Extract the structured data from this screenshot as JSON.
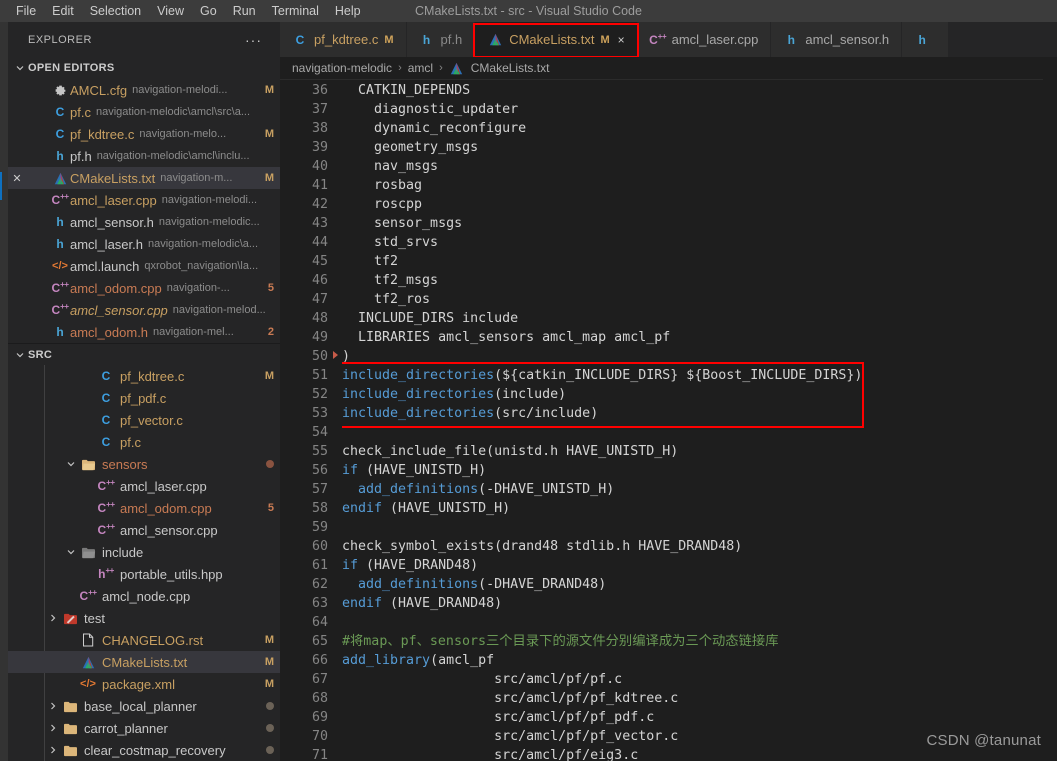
{
  "window": {
    "title": "CMakeLists.txt - src - Visual Studio Code",
    "menus": [
      "File",
      "Edit",
      "Selection",
      "View",
      "Go",
      "Run",
      "Terminal",
      "Help"
    ]
  },
  "sidebar": {
    "title": "EXPLORER",
    "more_actions": "···",
    "sections": [
      {
        "label": "OPEN EDITORS"
      },
      {
        "label": "SRC"
      }
    ],
    "open_editors": [
      {
        "icon": "gear-icon",
        "icon_glyph": "⚙",
        "icon_color": "#c5c5c5",
        "name": "AMCL.cfg",
        "name_color": "#c8a062",
        "desc": "navigation-melodi...",
        "badge": "M",
        "badge_color": "#c8a062",
        "selected": false,
        "closable": false
      },
      {
        "icon": "c-file-icon",
        "icon_glyph": "C",
        "icon_color": "#3d9fe0",
        "name": "pf.c",
        "name_color": "#c8a062",
        "desc": "navigation-melodic\\amcl\\src\\a...",
        "badge": "",
        "badge_color": "",
        "selected": false,
        "closable": false
      },
      {
        "icon": "c-file-icon",
        "icon_glyph": "C",
        "icon_color": "#3d9fe0",
        "name": "pf_kdtree.c",
        "name_color": "#c8a062",
        "desc": "navigation-melo...",
        "badge": "M",
        "badge_color": "#c8a062",
        "selected": false,
        "closable": false
      },
      {
        "icon": "h-file-icon",
        "icon_glyph": "h",
        "icon_color": "#4aa5d6",
        "name": "pf.h",
        "name_color": "#c8c8c8",
        "desc": "navigation-melodic\\amcl\\inclu...",
        "badge": "",
        "badge_color": "",
        "selected": false,
        "closable": false
      },
      {
        "icon": "cmake-icon",
        "icon_glyph": "▲",
        "icon_color": "#dd4c3f",
        "name": "CMakeLists.txt",
        "name_color": "#c8a062",
        "desc": "navigation-m...",
        "badge": "M",
        "badge_color": "#c8a062",
        "selected": true,
        "closable": true
      },
      {
        "icon": "cpp-file-icon",
        "icon_glyph": "C⁺⁺",
        "icon_color": "#c586c0",
        "name": "amcl_laser.cpp",
        "name_color": "#c8a062",
        "desc": "navigation-melodi...",
        "badge": "",
        "badge_color": "",
        "selected": false,
        "closable": false
      },
      {
        "icon": "h-file-icon",
        "icon_glyph": "h",
        "icon_color": "#4aa5d6",
        "name": "amcl_sensor.h",
        "name_color": "#c8c8c8",
        "desc": "navigation-melodic...",
        "badge": "",
        "badge_color": "",
        "selected": false,
        "closable": false
      },
      {
        "icon": "h-file-icon",
        "icon_glyph": "h",
        "icon_color": "#4aa5d6",
        "name": "amcl_laser.h",
        "name_color": "#c8c8c8",
        "desc": "navigation-melodic\\a...",
        "badge": "",
        "badge_color": "",
        "selected": false,
        "closable": false
      },
      {
        "icon": "xml-file-icon",
        "icon_glyph": "</>",
        "icon_color": "#e37933",
        "name": "amcl.launch",
        "name_color": "#c8c8c8",
        "desc": "qxrobot_navigation\\la...",
        "badge": "",
        "badge_color": "",
        "selected": false,
        "closable": false
      },
      {
        "icon": "cpp-file-icon",
        "icon_glyph": "C⁺⁺",
        "icon_color": "#c586c0",
        "name": "amcl_odom.cpp",
        "name_color": "#c97b54",
        "desc": "navigation-...",
        "badge": "5",
        "badge_color": "#c97b54",
        "selected": false,
        "closable": false
      },
      {
        "icon": "cpp-file-icon",
        "icon_glyph": "C⁺⁺",
        "icon_color": "#c586c0",
        "name": "amcl_sensor.cpp",
        "name_color": "#c8a062",
        "desc": "navigation-melod...",
        "badge": "",
        "badge_color": "",
        "selected": false,
        "closable": false,
        "italic": true
      },
      {
        "icon": "h-file-icon",
        "icon_glyph": "h",
        "icon_color": "#4aa5d6",
        "name": "amcl_odom.h",
        "name_color": "#c97b54",
        "desc": "navigation-mel...",
        "badge": "2",
        "badge_color": "#c97b54",
        "selected": false,
        "closable": false
      }
    ],
    "src_tree": [
      {
        "depth": 3,
        "kind": "file",
        "icon": "c-file-icon",
        "icon_glyph": "C",
        "icon_color": "#3d9fe0",
        "name": "pf_kdtree.c",
        "name_color": "#c8a062",
        "badge": "M",
        "badge_color": "#c8a062",
        "selected": false
      },
      {
        "depth": 3,
        "kind": "file",
        "icon": "c-file-icon",
        "icon_glyph": "C",
        "icon_color": "#3d9fe0",
        "name": "pf_pdf.c",
        "name_color": "#c8a062",
        "badge": "",
        "badge_color": "",
        "selected": false
      },
      {
        "depth": 3,
        "kind": "file",
        "icon": "c-file-icon",
        "icon_glyph": "C",
        "icon_color": "#3d9fe0",
        "name": "pf_vector.c",
        "name_color": "#c8a062",
        "badge": "",
        "badge_color": "",
        "selected": false
      },
      {
        "depth": 3,
        "kind": "file",
        "icon": "c-file-icon",
        "icon_glyph": "C",
        "icon_color": "#3d9fe0",
        "name": "pf.c",
        "name_color": "#c8a062",
        "badge": "",
        "badge_color": "",
        "selected": false
      },
      {
        "depth": 2,
        "kind": "folder-open",
        "icon": "folder-open-icon",
        "name": "sensors",
        "name_color": "#c97b54",
        "badge": "●",
        "badge_color": "#8a5340",
        "selected": false
      },
      {
        "depth": 3,
        "kind": "file",
        "icon": "cpp-file-icon",
        "icon_glyph": "C⁺⁺",
        "icon_color": "#c586c0",
        "name": "amcl_laser.cpp",
        "name_color": "#c8c8c8",
        "badge": "",
        "badge_color": "",
        "selected": false
      },
      {
        "depth": 3,
        "kind": "file",
        "icon": "cpp-file-icon",
        "icon_glyph": "C⁺⁺",
        "icon_color": "#c586c0",
        "name": "amcl_odom.cpp",
        "name_color": "#c97b54",
        "badge": "5",
        "badge_color": "#c97b54",
        "selected": false
      },
      {
        "depth": 3,
        "kind": "file",
        "icon": "cpp-file-icon",
        "icon_glyph": "C⁺⁺",
        "icon_color": "#c586c0",
        "name": "amcl_sensor.cpp",
        "name_color": "#c8c8c8",
        "badge": "",
        "badge_color": "",
        "selected": false
      },
      {
        "depth": 2,
        "kind": "folder-open",
        "icon": "folder-open-gray-icon",
        "name": "include",
        "name_color": "#c8c8c8",
        "badge": "",
        "badge_color": "",
        "selected": false
      },
      {
        "depth": 3,
        "kind": "file",
        "icon": "hpp-file-icon",
        "icon_glyph": "h⁺⁺",
        "icon_color": "#c586c0",
        "name": "portable_utils.hpp",
        "name_color": "#c8c8c8",
        "badge": "",
        "badge_color": "",
        "selected": false
      },
      {
        "depth": 2,
        "kind": "file",
        "icon": "cpp-file-icon",
        "icon_glyph": "C⁺⁺",
        "icon_color": "#c586c0",
        "name": "amcl_node.cpp",
        "name_color": "#c8c8c8",
        "badge": "",
        "badge_color": "",
        "selected": false
      },
      {
        "depth": 1,
        "kind": "folder-closed",
        "icon": "folder-test-icon",
        "name": "test",
        "name_color": "#c8c8c8",
        "badge": "",
        "badge_color": "",
        "selected": false
      },
      {
        "depth": 2,
        "kind": "file",
        "icon": "rst-file-icon",
        "icon_glyph": "⬜",
        "icon_color": "#c8c8c8",
        "name": "CHANGELOG.rst",
        "name_color": "#c8a062",
        "badge": "M",
        "badge_color": "#c8a062",
        "selected": false
      },
      {
        "depth": 2,
        "kind": "file",
        "icon": "cmake-icon",
        "icon_glyph": "▲",
        "icon_color": "#dd4c3f",
        "name": "CMakeLists.txt",
        "name_color": "#c8a062",
        "badge": "M",
        "badge_color": "#c8a062",
        "selected": true
      },
      {
        "depth": 2,
        "kind": "file",
        "icon": "xml-file-icon",
        "icon_glyph": "</>",
        "icon_color": "#e37933",
        "name": "package.xml",
        "name_color": "#c8a062",
        "badge": "M",
        "badge_color": "#c8a062",
        "selected": false
      },
      {
        "depth": 1,
        "kind": "folder-closed",
        "icon": "folder-closed-icon",
        "name": "base_local_planner",
        "name_color": "#c8c8c8",
        "badge": "●",
        "badge_color": "#6b6257",
        "selected": false
      },
      {
        "depth": 1,
        "kind": "folder-closed",
        "icon": "folder-closed-icon",
        "name": "carrot_planner",
        "name_color": "#c8c8c8",
        "badge": "●",
        "badge_color": "#6b6257",
        "selected": false
      },
      {
        "depth": 1,
        "kind": "folder-closed",
        "icon": "folder-closed-icon",
        "name": "clear_costmap_recovery",
        "name_color": "#c8c8c8",
        "badge": "●",
        "badge_color": "#6b6257",
        "selected": false
      }
    ]
  },
  "tabs": [
    {
      "icon": "c-file-icon",
      "icon_glyph": "C",
      "icon_color": "#3d9fe0",
      "label": "pf_kdtree.c",
      "dirty": "M",
      "active": false,
      "closable": false,
      "label_color": "#c8a062"
    },
    {
      "icon": "h-file-icon",
      "icon_glyph": "h",
      "icon_color": "#4aa5d6",
      "label": "pf.h",
      "dirty": "",
      "active": false,
      "closable": false,
      "label_color": "#8a8a8a"
    },
    {
      "icon": "cmake-icon",
      "icon_glyph": "▲",
      "icon_color": "#dd4c3f",
      "label": "CMakeLists.txt",
      "dirty": "M",
      "active": true,
      "closable": true,
      "close_glyph": "×",
      "label_color": "#c8a062"
    },
    {
      "icon": "cpp-file-icon",
      "icon_glyph": "C⁺⁺",
      "icon_color": "#c586c0",
      "label": "amcl_laser.cpp",
      "dirty": "",
      "active": false,
      "closable": false,
      "label_color": "#a8a8a8"
    },
    {
      "icon": "h-file-icon",
      "icon_glyph": "h",
      "icon_color": "#4aa5d6",
      "label": "amcl_sensor.h",
      "dirty": "",
      "active": false,
      "closable": false,
      "label_color": "#a8a8a8"
    },
    {
      "icon": "h-file-icon",
      "icon_glyph": "h",
      "icon_color": "#4aa5d6",
      "label": "",
      "dirty": "",
      "active": false,
      "closable": false,
      "label_color": "#a8a8a8"
    }
  ],
  "breadcrumbs": {
    "items": [
      "navigation-melodic",
      "amcl",
      "CMakeLists.txt"
    ],
    "separator": "›",
    "file_icon": "cmake-icon",
    "file_icon_glyph": "▲"
  },
  "editor": {
    "first_line": 36,
    "highlight_color": "#ff0000",
    "lines": [
      {
        "n": 36,
        "segs": [
          {
            "t": "  CATKIN_DEPENDS",
            "c": "t-plain"
          }
        ]
      },
      {
        "n": 37,
        "segs": [
          {
            "t": "    diagnostic_updater",
            "c": "t-plain"
          }
        ]
      },
      {
        "n": 38,
        "segs": [
          {
            "t": "    dynamic_reconfigure",
            "c": "t-plain"
          }
        ]
      },
      {
        "n": 39,
        "segs": [
          {
            "t": "    geometry_msgs",
            "c": "t-plain"
          }
        ]
      },
      {
        "n": 40,
        "segs": [
          {
            "t": "    nav_msgs",
            "c": "t-plain"
          }
        ]
      },
      {
        "n": 41,
        "segs": [
          {
            "t": "    rosbag",
            "c": "t-plain"
          }
        ]
      },
      {
        "n": 42,
        "segs": [
          {
            "t": "    roscpp",
            "c": "t-plain"
          }
        ]
      },
      {
        "n": 43,
        "segs": [
          {
            "t": "    sensor_msgs",
            "c": "t-plain"
          }
        ]
      },
      {
        "n": 44,
        "segs": [
          {
            "t": "    std_srvs",
            "c": "t-plain"
          }
        ]
      },
      {
        "n": 45,
        "segs": [
          {
            "t": "    tf2",
            "c": "t-plain"
          }
        ]
      },
      {
        "n": 46,
        "segs": [
          {
            "t": "    tf2_msgs",
            "c": "t-plain"
          }
        ]
      },
      {
        "n": 47,
        "segs": [
          {
            "t": "    tf2_ros",
            "c": "t-plain"
          }
        ]
      },
      {
        "n": 48,
        "segs": [
          {
            "t": "  INCLUDE_DIRS include",
            "c": "t-plain"
          }
        ]
      },
      {
        "n": 49,
        "segs": [
          {
            "t": "  LIBRARIES amcl_sensors amcl_map amcl_pf",
            "c": "t-plain"
          }
        ]
      },
      {
        "n": 50,
        "segs": [
          {
            "t": ")",
            "c": "t-plain"
          }
        ],
        "fold": true
      },
      {
        "n": 51,
        "segs": [
          {
            "t": "include_directories",
            "c": "t-fn"
          },
          {
            "t": "(",
            "c": "t-punct"
          },
          {
            "t": "${catkin_INCLUDE_DIRS} ${Boost_INCLUDE_DIRS}",
            "c": "t-plain"
          },
          {
            "t": ")",
            "c": "t-punct"
          }
        ],
        "boxed": true
      },
      {
        "n": 52,
        "segs": [
          {
            "t": "include_directories",
            "c": "t-fn"
          },
          {
            "t": "(",
            "c": "t-punct"
          },
          {
            "t": "include",
            "c": "t-plain"
          },
          {
            "t": ")",
            "c": "t-punct"
          }
        ],
        "boxed": true
      },
      {
        "n": 53,
        "segs": [
          {
            "t": "include_directories",
            "c": "t-fn"
          },
          {
            "t": "(",
            "c": "t-punct"
          },
          {
            "t": "src/include",
            "c": "t-plain"
          },
          {
            "t": ")",
            "c": "t-punct"
          }
        ],
        "boxed": true
      },
      {
        "n": 54,
        "segs": [
          {
            "t": "",
            "c": "t-plain"
          }
        ]
      },
      {
        "n": 55,
        "segs": [
          {
            "t": "check_include_file",
            "c": "t-plain"
          },
          {
            "t": "(unistd.h HAVE_UNISTD_H)",
            "c": "t-plain"
          }
        ]
      },
      {
        "n": 56,
        "segs": [
          {
            "t": "if",
            "c": "t-kw"
          },
          {
            "t": " (HAVE_UNISTD_H)",
            "c": "t-plain"
          }
        ]
      },
      {
        "n": 57,
        "segs": [
          {
            "t": "  ",
            "c": "t-plain"
          },
          {
            "t": "add_definitions",
            "c": "t-fn"
          },
          {
            "t": "(-DHAVE_UNISTD_H)",
            "c": "t-plain"
          }
        ]
      },
      {
        "n": 58,
        "segs": [
          {
            "t": "endif",
            "c": "t-kw"
          },
          {
            "t": " (HAVE_UNISTD_H)",
            "c": "t-plain"
          }
        ]
      },
      {
        "n": 59,
        "segs": [
          {
            "t": "",
            "c": "t-plain"
          }
        ]
      },
      {
        "n": 60,
        "segs": [
          {
            "t": "check_symbol_exists",
            "c": "t-plain"
          },
          {
            "t": "(drand48 stdlib.h HAVE_DRAND48)",
            "c": "t-plain"
          }
        ]
      },
      {
        "n": 61,
        "segs": [
          {
            "t": "if",
            "c": "t-kw"
          },
          {
            "t": " (HAVE_DRAND48)",
            "c": "t-plain"
          }
        ]
      },
      {
        "n": 62,
        "segs": [
          {
            "t": "  ",
            "c": "t-plain"
          },
          {
            "t": "add_definitions",
            "c": "t-fn"
          },
          {
            "t": "(-DHAVE_DRAND48)",
            "c": "t-plain"
          }
        ]
      },
      {
        "n": 63,
        "segs": [
          {
            "t": "endif",
            "c": "t-kw"
          },
          {
            "t": " (HAVE_DRAND48)",
            "c": "t-plain"
          }
        ]
      },
      {
        "n": 64,
        "segs": [
          {
            "t": "",
            "c": "t-plain"
          }
        ]
      },
      {
        "n": 65,
        "segs": [
          {
            "t": "#将map、pf、sensors三个目录下的源文件分别编译成为三个动态链接库",
            "c": "t-comment"
          }
        ]
      },
      {
        "n": 66,
        "segs": [
          {
            "t": "add_library",
            "c": "t-fn"
          },
          {
            "t": "(amcl_pf",
            "c": "t-plain"
          }
        ]
      },
      {
        "n": 67,
        "segs": [
          {
            "t": "                   src/amcl/pf/pf.c",
            "c": "t-plain"
          }
        ]
      },
      {
        "n": 68,
        "segs": [
          {
            "t": "                   src/amcl/pf/pf_kdtree.c",
            "c": "t-plain"
          }
        ]
      },
      {
        "n": 69,
        "segs": [
          {
            "t": "                   src/amcl/pf/pf_pdf.c",
            "c": "t-plain"
          }
        ]
      },
      {
        "n": 70,
        "segs": [
          {
            "t": "                   src/amcl/pf/pf_vector.c",
            "c": "t-plain"
          }
        ]
      },
      {
        "n": 71,
        "segs": [
          {
            "t": "                   src/amcl/pf/eig3.c",
            "c": "t-plain"
          }
        ]
      }
    ]
  },
  "watermark": "CSDN @tanunat"
}
